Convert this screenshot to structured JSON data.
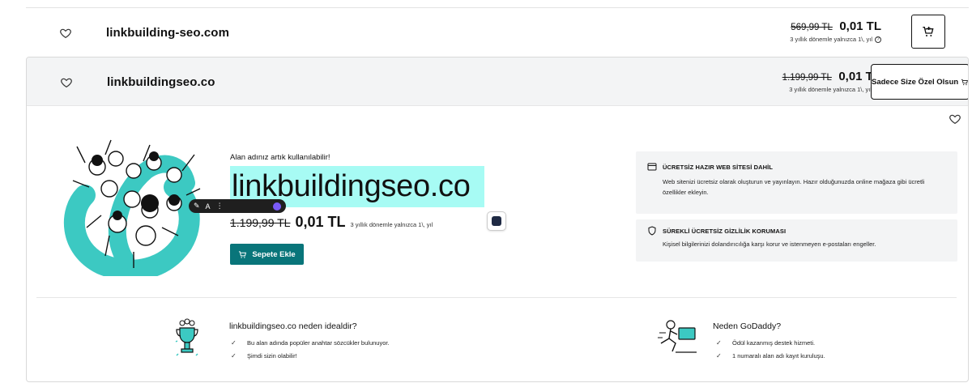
{
  "rows": [
    {
      "domain": "linkbuilding-seo.com",
      "old_price": "569,99 TL",
      "new_price": "0,01 TL",
      "price_note": "3 yıllık dönemle yalnızca 1\\, yıl"
    },
    {
      "domain": "linkbuildingseo.co",
      "old_price": "1.199,99 TL",
      "new_price": "0,01 TL",
      "price_note": "3 yıllık dönemle yalnızca 1\\, yıl",
      "special_label": "Sadece Size Özel Olsun"
    }
  ],
  "detail": {
    "available_text": "Alan adınız artık kullanılabilir!",
    "domain": "linkbuildingseo.co",
    "old_price": "1.199,99 TL",
    "new_price": "0,01 TL",
    "price_note": "3 yıllık dönemle yalnızca 1\\, yıl",
    "add_to_cart": "Sepete Ekle"
  },
  "features": [
    {
      "icon": "browser-icon",
      "title": "ÜCRETSİZ HAZIR WEB SİTESİ DAHİL",
      "desc": "Web sitenizi ücretsiz olarak oluşturun ve yayınlayın. Hazır olduğunuzda online mağaza gibi ücretli özellikler ekleyin."
    },
    {
      "icon": "shield-icon",
      "title": "SÜREKLİ ÜCRETSİZ GİZLİLİK KORUMASI",
      "desc": "Kişisel bilgilerinizi dolandırıcılığa karşı korur ve istenmeyen e-postaları engeller."
    }
  ],
  "ideal": {
    "title": "linkbuildingseo.co neden idealdir?",
    "items": [
      "Bu alan adında popüler anahtar sözcükler bulunuyor.",
      "Şimdi sizin olabilir!"
    ]
  },
  "why": {
    "title": "Neden GoDaddy?",
    "items": [
      "Ödül kazanmış destek hizmeti.",
      "1 numaralı alan adı kayıt kuruluşu."
    ]
  },
  "colors": {
    "accent": "#09757a",
    "highlight": "#a7fbf4",
    "panel": "#f3f4f5",
    "illustration_teal": "#3cc9c2"
  }
}
